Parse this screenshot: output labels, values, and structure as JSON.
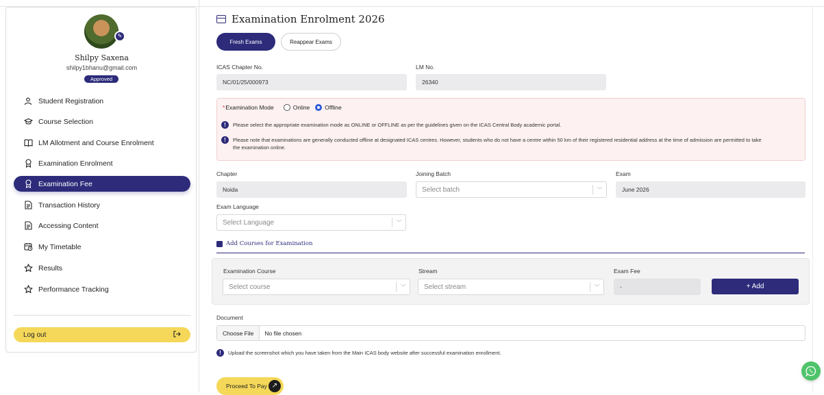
{
  "profile": {
    "name": "Shilpy Saxena",
    "email": "shilpy1bhanu@gmail.com",
    "status": "Approved"
  },
  "sidebar": {
    "items": [
      {
        "label": "Student Registration",
        "icon": "user-icon"
      },
      {
        "label": "Course Selection",
        "icon": "graduation-cap-icon"
      },
      {
        "label": "LM Allotment and Course Enrolment",
        "icon": "book-open-icon"
      },
      {
        "label": "Examination Enrolment",
        "icon": "badge-icon"
      },
      {
        "label": "Examination Fee",
        "icon": "badge-icon",
        "active": true
      },
      {
        "label": "Transaction History",
        "icon": "document-icon"
      },
      {
        "label": "Accessing Content",
        "icon": "document-icon"
      },
      {
        "label": "My Timetable",
        "icon": "calendar-clock-icon"
      },
      {
        "label": "Results",
        "icon": "star-icon"
      },
      {
        "label": "Performance Tracking",
        "icon": "star-icon"
      }
    ],
    "logout_label": "Log out"
  },
  "main": {
    "title": "Examination Enrolment 2026",
    "tabs": [
      {
        "label": "Fresh Exams",
        "active": true
      },
      {
        "label": "Reappear Exams",
        "active": false
      }
    ],
    "chapter_no_label": "ICAS Chapter No.",
    "chapter_no_value": "NC/01/25/000973",
    "lm_no_label": "LM No.",
    "lm_no_value": "26340",
    "mode": {
      "required_mark": "*",
      "label": "Examination Mode",
      "options": [
        "Online",
        "Offline"
      ],
      "selected": "Offline"
    },
    "notices": [
      "Please select the appropriate examination mode as ONLINE or OFFLINE as per the guidelines given on the ICAS Central Body academic portal.",
      "Please note that examinations are generally conducted offline at designated ICAS centres. However, students who do not have a centre within 50 km of their registered residential address at the time of admission are permitted to take the examination online."
    ],
    "chapter_label": "Chapter",
    "chapter_value": "Noida",
    "batch_label": "Joining Batch",
    "batch_placeholder": "Select batch",
    "exam_label": "Exam",
    "exam_value": "June 2026",
    "language_label": "Exam Language",
    "language_placeholder": "Select Language",
    "courses_heading": "Add Courses for Examination",
    "course_label": "Examination Course",
    "course_placeholder": "Select course",
    "stream_label": "Stream",
    "stream_placeholder": "Select stream",
    "fee_label": "Exam Fee",
    "fee_value": "-",
    "add_label": "+ Add",
    "document_label": "Document",
    "file_button": "Choose File",
    "file_status": "No file chosen",
    "upload_note": "Upload the screenshot which you have taken from the Main ICAS body website after successful examination enrollment.",
    "proceed_label": "Proceed To Pay"
  },
  "colors": {
    "brand": "#2d2b7a",
    "accent_yellow": "#f5d85a",
    "notice_bg": "#fdf1f1",
    "whatsapp": "#4fc46b"
  }
}
